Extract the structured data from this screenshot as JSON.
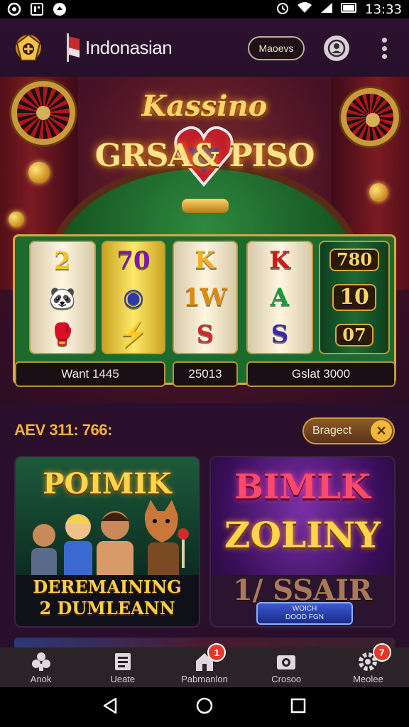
{
  "status_bar": {
    "time": "13:33",
    "left_icons": [
      "chrome-icon",
      "notification-icon",
      "app-icon"
    ],
    "right_icons": [
      "alarm-icon",
      "wifi-icon",
      "signal-icon",
      "battery-icon"
    ]
  },
  "header": {
    "app_title": "Indonasian",
    "action_button_label": "Maoevs",
    "icons": [
      "casino-logo-icon",
      "flag-icon",
      "account-icon",
      "more-vert-icon"
    ]
  },
  "hero": {
    "title_line1": "Kassino",
    "title_line2": "GRSA& PISO"
  },
  "slot": {
    "reels": [
      [
        "2",
        "🐼",
        "🥊"
      ],
      [
        "70",
        "◉",
        "⚡"
      ],
      [
        "K",
        "1W",
        "S"
      ],
      [
        "K",
        "A",
        "S"
      ],
      [
        "780",
        "10",
        "07"
      ]
    ],
    "labels": [
      "Want 1445",
      "25013",
      "Gslat 3000"
    ]
  },
  "promo": {
    "text": "AEV 311: 766:",
    "chip_label": "Bragect",
    "chip_close": "✕"
  },
  "cards": [
    {
      "title": "POIMIK",
      "subtitle_line1": "DEREMAINING",
      "subtitle_line2": "2 DUMLEANN"
    },
    {
      "title_line1": "BIMLK",
      "title_line2": "ZOLINY",
      "subtitle": "1/ SSAIR",
      "button_line1": "WOICH",
      "button_line2": "DOOD FGN"
    }
  ],
  "bottom_nav": [
    {
      "label": "Anok",
      "icon": "puzzle-icon",
      "badge": ""
    },
    {
      "label": "Ueate",
      "icon": "document-icon",
      "badge": ""
    },
    {
      "label": "Pabmanlon",
      "icon": "home-icon",
      "badge": "1"
    },
    {
      "label": "Crosoo",
      "icon": "camera-icon",
      "badge": ""
    },
    {
      "label": "Meolee",
      "icon": "settings-icon",
      "badge": "7"
    }
  ],
  "colors": {
    "background": "#2a0f2c",
    "accent_gold": "#f5b23a",
    "badge_red": "#e03a2a",
    "felt_green": "#1c6a2c"
  }
}
